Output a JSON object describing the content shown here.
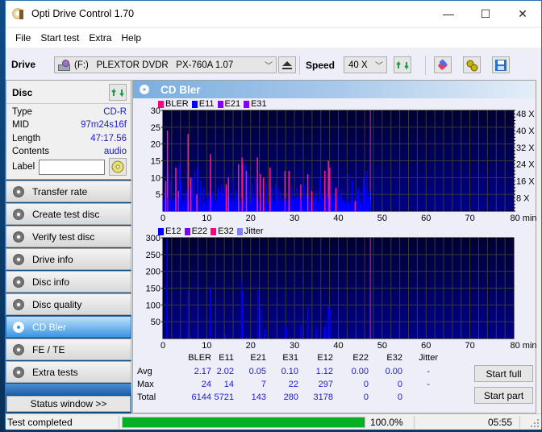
{
  "window": {
    "title": "Opti Drive Control 1.70",
    "controls": {
      "minimize": "—",
      "maximize": "☐",
      "close": "✕"
    }
  },
  "menu": [
    "File",
    "Start test",
    "Extra",
    "Help"
  ],
  "toolbar": {
    "drive_label": "Drive",
    "drive_value": "(F:)   PLEXTOR DVDR   PX-760A 1.07",
    "speed_label": "Speed",
    "speed_value": "40 X",
    "icons": [
      "eject-icon",
      "refresh-icon",
      "erase-icon",
      "settings-icon",
      "save-icon"
    ]
  },
  "disc": {
    "header": "Disc",
    "rows": [
      {
        "label": "Type",
        "value": "CD-R"
      },
      {
        "label": "MID",
        "value": "97m24s16f"
      },
      {
        "label": "Length",
        "value": "47:17.56"
      },
      {
        "label": "Contents",
        "value": "audio"
      }
    ],
    "label_field": {
      "label": "Label",
      "value": ""
    }
  },
  "nav": [
    {
      "label": "Transfer rate",
      "active": false
    },
    {
      "label": "Create test disc",
      "active": false
    },
    {
      "label": "Verify test disc",
      "active": false
    },
    {
      "label": "Drive info",
      "active": false
    },
    {
      "label": "Disc info",
      "active": false
    },
    {
      "label": "Disc quality",
      "active": false
    },
    {
      "label": "CD Bler",
      "active": true
    },
    {
      "label": "FE / TE",
      "active": false
    },
    {
      "label": "Extra tests",
      "active": false
    }
  ],
  "status_window_button": "Status window >>",
  "main": {
    "title": "CD Bler"
  },
  "chart_data": [
    {
      "type": "bar",
      "title": "CD Bler - BLER / E11 / E21 / E31",
      "legend": [
        {
          "name": "BLER",
          "color": "#ff0080"
        },
        {
          "name": "E11",
          "color": "#0000ff"
        },
        {
          "name": "E21",
          "color": "#8000ff"
        },
        {
          "name": "E31",
          "color": "#8000ff"
        }
      ],
      "xlabel": "min",
      "xlim": [
        0,
        80
      ],
      "xticks": [
        0,
        10,
        20,
        30,
        40,
        50,
        60,
        70,
        80
      ],
      "ylim": [
        0,
        30
      ],
      "yticks": [
        5,
        10,
        15,
        20,
        25,
        30
      ],
      "y2ticks": [
        "8 X",
        "16 X",
        "24 X",
        "32 X",
        "40 X",
        "48 X"
      ],
      "disc_end_min": 47.3,
      "bler_spikes": [
        {
          "x": 0.5,
          "y": 9
        },
        {
          "x": 0.9,
          "y": 24
        },
        {
          "x": 2.8,
          "y": 13
        },
        {
          "x": 3.4,
          "y": 6
        },
        {
          "x": 5.6,
          "y": 23
        },
        {
          "x": 6.2,
          "y": 10
        },
        {
          "x": 7.6,
          "y": 5
        },
        {
          "x": 10.7,
          "y": 17
        },
        {
          "x": 14.8,
          "y": 10
        },
        {
          "x": 14.3,
          "y": 8
        },
        {
          "x": 17.1,
          "y": 14
        },
        {
          "x": 17.9,
          "y": 16
        },
        {
          "x": 18.0,
          "y": 14
        },
        {
          "x": 18.9,
          "y": 12
        },
        {
          "x": 21.4,
          "y": 16
        },
        {
          "x": 22.1,
          "y": 11
        },
        {
          "x": 22.8,
          "y": 10
        },
        {
          "x": 24.3,
          "y": 13
        },
        {
          "x": 27.7,
          "y": 12
        },
        {
          "x": 28.6,
          "y": 12
        },
        {
          "x": 31.3,
          "y": 8
        },
        {
          "x": 32.9,
          "y": 11
        },
        {
          "x": 33.8,
          "y": 6
        },
        {
          "x": 36.8,
          "y": 12
        },
        {
          "x": 37.6,
          "y": 15
        },
        {
          "x": 37.9,
          "y": 13
        },
        {
          "x": 39.3,
          "y": 7
        },
        {
          "x": 43.7,
          "y": 3
        }
      ],
      "e11_envelope_avg": 4,
      "e11_peaks": [
        {
          "x": 0.3,
          "y": 6
        },
        {
          "x": 1.2,
          "y": 11
        },
        {
          "x": 1.6,
          "y": 9
        },
        {
          "x": 2.9,
          "y": 12
        },
        {
          "x": 3.6,
          "y": 14
        },
        {
          "x": 4.0,
          "y": 9
        },
        {
          "x": 5.2,
          "y": 6
        },
        {
          "x": 6.6,
          "y": 10
        },
        {
          "x": 7.1,
          "y": 12
        },
        {
          "x": 7.7,
          "y": 13
        },
        {
          "x": 8.4,
          "y": 9
        },
        {
          "x": 9.1,
          "y": 7
        },
        {
          "x": 10.1,
          "y": 6
        },
        {
          "x": 11.2,
          "y": 6
        },
        {
          "x": 12.5,
          "y": 7
        },
        {
          "x": 13.2,
          "y": 8
        },
        {
          "x": 14.0,
          "y": 7
        },
        {
          "x": 15.9,
          "y": 9
        },
        {
          "x": 16.5,
          "y": 6
        },
        {
          "x": 18.7,
          "y": 14
        },
        {
          "x": 19.4,
          "y": 11
        },
        {
          "x": 20.3,
          "y": 8
        },
        {
          "x": 21.0,
          "y": 10
        },
        {
          "x": 23.4,
          "y": 8
        },
        {
          "x": 24.7,
          "y": 7
        },
        {
          "x": 25.5,
          "y": 8
        },
        {
          "x": 26.6,
          "y": 6
        },
        {
          "x": 29.2,
          "y": 7
        },
        {
          "x": 30.4,
          "y": 7
        },
        {
          "x": 32.0,
          "y": 8
        },
        {
          "x": 34.7,
          "y": 6
        },
        {
          "x": 35.7,
          "y": 10
        },
        {
          "x": 36.6,
          "y": 9
        },
        {
          "x": 38.4,
          "y": 9
        },
        {
          "x": 39.8,
          "y": 7
        },
        {
          "x": 40.6,
          "y": 6
        },
        {
          "x": 42.1,
          "y": 11
        },
        {
          "x": 43.0,
          "y": 9
        },
        {
          "x": 44.5,
          "y": 7
        },
        {
          "x": 45.6,
          "y": 10
        },
        {
          "x": 46.4,
          "y": 12
        },
        {
          "x": 47.0,
          "y": 6
        }
      ]
    },
    {
      "type": "bar",
      "title": "CD Bler - E12 / E22 / E32 / Jitter",
      "legend": [
        {
          "name": "E12",
          "color": "#0000ff"
        },
        {
          "name": "E22",
          "color": "#8000ff"
        },
        {
          "name": "E32",
          "color": "#ff0080"
        },
        {
          "name": "Jitter",
          "color": "#8080ff"
        }
      ],
      "xlabel": "min",
      "xlim": [
        0,
        80
      ],
      "xticks": [
        0,
        10,
        20,
        30,
        40,
        50,
        60,
        70,
        80
      ],
      "ylim": [
        0,
        300
      ],
      "yticks": [
        50,
        100,
        150,
        200,
        250,
        300
      ],
      "disc_end_min": 47.3,
      "e12_spikes": [
        {
          "x": 0.8,
          "y": 297
        },
        {
          "x": 5.6,
          "y": 143
        },
        {
          "x": 10.7,
          "y": 155
        },
        {
          "x": 14.1,
          "y": 15
        },
        {
          "x": 17.8,
          "y": 172
        },
        {
          "x": 18.0,
          "y": 140
        },
        {
          "x": 18.9,
          "y": 5
        },
        {
          "x": 21.5,
          "y": 143
        },
        {
          "x": 22.2,
          "y": 88
        },
        {
          "x": 23.1,
          "y": 28
        },
        {
          "x": 27.9,
          "y": 37
        },
        {
          "x": 31.3,
          "y": 38
        },
        {
          "x": 32.9,
          "y": 95
        },
        {
          "x": 34.8,
          "y": 30
        },
        {
          "x": 36.7,
          "y": 30
        },
        {
          "x": 36.9,
          "y": 42
        },
        {
          "x": 37.6,
          "y": 100
        },
        {
          "x": 37.8,
          "y": 92
        }
      ]
    }
  ],
  "stats": {
    "columns": [
      "BLER",
      "E11",
      "E21",
      "E31",
      "E12",
      "E22",
      "E32",
      "Jitter"
    ],
    "rows": [
      {
        "label": "Avg",
        "values": [
          "2.17",
          "2.02",
          "0.05",
          "0.10",
          "1.12",
          "0.00",
          "0.00",
          "-"
        ]
      },
      {
        "label": "Max",
        "values": [
          "24",
          "14",
          "7",
          "22",
          "297",
          "0",
          "0",
          "-"
        ]
      },
      {
        "label": "Total",
        "values": [
          "6144",
          "5721",
          "143",
          "280",
          "3178",
          "0",
          "0",
          ""
        ]
      }
    ]
  },
  "buttons": {
    "start_full": "Start full",
    "start_part": "Start part"
  },
  "statusbar": {
    "text": "Test completed",
    "progress": 100.0,
    "progress_text": "100.0%",
    "time": "05:55"
  }
}
